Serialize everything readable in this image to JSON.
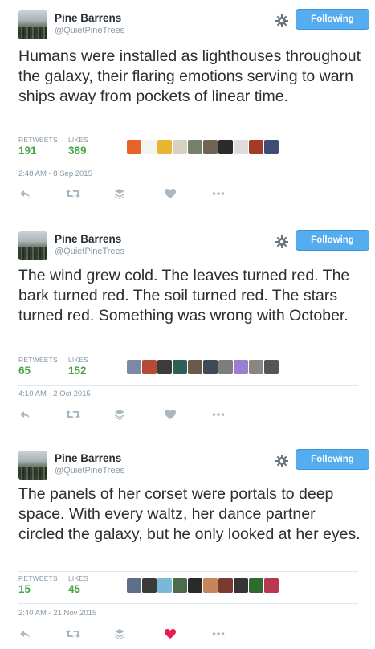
{
  "tweets": [
    {
      "user": {
        "name": "Pine Barrens",
        "handle": "@QuietPineTrees"
      },
      "follow_label": "Following",
      "text": "Humans were installed as lighthouses throughout the galaxy, their flaring emotions serving to warn ships away from pockets of linear time.",
      "retweets_label": "RETWEETS",
      "retweets": "191",
      "likes_label": "LIKES",
      "likes": "389",
      "timestamp": "2:48 AM - 8 Sep 2015",
      "liked": false,
      "face_colors": [
        "#e8632c",
        "#f3f3f3",
        "#e6b532",
        "#d7d1c2",
        "#73806b",
        "#6f6453",
        "#2b2b2b",
        "#dcdcdc",
        "#a53a24",
        "#3f4c78"
      ]
    },
    {
      "user": {
        "name": "Pine Barrens",
        "handle": "@QuietPineTrees"
      },
      "follow_label": "Following",
      "text": "The wind grew cold. The leaves turned red. The bark turned red. The soil turned red. The stars turned red. Something was wrong with October.",
      "retweets_label": "RETWEETS",
      "retweets": "65",
      "likes_label": "LIKES",
      "likes": "152",
      "timestamp": "4:10 AM - 2 Oct 2015",
      "liked": false,
      "face_colors": [
        "#7a8aa6",
        "#b54b34",
        "#3b3b3b",
        "#2d5f5a",
        "#6b5a4a",
        "#404a55",
        "#7d7d7d",
        "#9a7fd1",
        "#8b8680",
        "#555555"
      ]
    },
    {
      "user": {
        "name": "Pine Barrens",
        "handle": "@QuietPineTrees"
      },
      "follow_label": "Following",
      "text": "The panels of her corset were portals to deep space. With every waltz, her dance partner circled the galaxy, but he only looked at her eyes.",
      "retweets_label": "RETWEETS",
      "retweets": "15",
      "likes_label": "LIKES",
      "likes": "45",
      "timestamp": "2:40 AM - 21 Nov 2015",
      "liked": true,
      "face_colors": [
        "#5e6d8a",
        "#3a3a3a",
        "#79b9d6",
        "#4c6a4c",
        "#2a2a2a",
        "#c8845a",
        "#7a3b2e",
        "#353535",
        "#2f6b2f",
        "#b8394f"
      ]
    }
  ],
  "colors": {
    "accent": "#55acee",
    "stat_value": "#47a547",
    "muted": "#8899a6",
    "heart_liked": "#e81c4f"
  },
  "icons": [
    "gear-icon",
    "reply-icon",
    "retweet-icon",
    "stack-icon",
    "heart-icon",
    "more-icon"
  ]
}
